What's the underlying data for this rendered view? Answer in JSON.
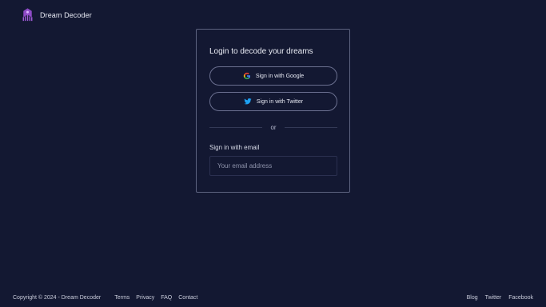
{
  "header": {
    "brand": "Dream Decoder",
    "logo_icon": "brain-logo-icon",
    "logo_color": "#8e4bc7"
  },
  "login": {
    "title": "Login to decode your dreams",
    "google_label": "Sign in with Google",
    "twitter_label": "Sign in with Twitter",
    "divider_text": "or",
    "email_label": "Sign in with email",
    "email_placeholder": "Your email address",
    "email_value": ""
  },
  "footer": {
    "copyright": "Copyright © 2024 - Dream Decoder",
    "links_left": [
      "Terms",
      "Privacy",
      "FAQ",
      "Contact"
    ],
    "links_right": [
      "Blog",
      "Twitter",
      "Facebook"
    ]
  },
  "colors": {
    "background": "#131832",
    "card_border": "#5d6380",
    "twitter_blue": "#1da1f2"
  }
}
